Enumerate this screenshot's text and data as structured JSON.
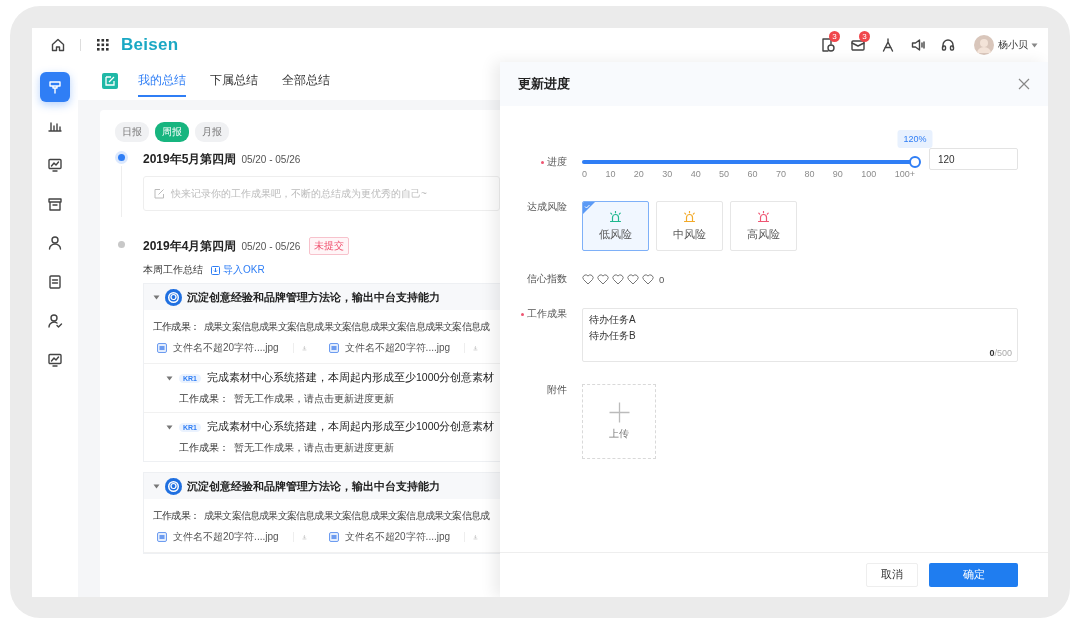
{
  "topbar": {
    "logo": "Beisen",
    "notifications": [
      {
        "badge": "3"
      },
      {
        "badge": "3"
      }
    ],
    "user": {
      "name": "杨小贝"
    }
  },
  "sidebar": {
    "items": [
      {
        "selected": true
      },
      {
        "selected": false
      },
      {
        "selected": false
      },
      {
        "selected": false
      },
      {
        "selected": false
      },
      {
        "selected": false
      },
      {
        "selected": false
      },
      {
        "selected": false
      }
    ]
  },
  "tabs": [
    {
      "label": "我的总结",
      "selected": true
    },
    {
      "label": "下属总结",
      "selected": false
    },
    {
      "label": "全部总结",
      "selected": false
    }
  ],
  "filters": [
    {
      "label": "日报",
      "selected": false
    },
    {
      "label": "周报",
      "selected": true
    },
    {
      "label": "月报",
      "selected": false
    }
  ],
  "weeks": [
    {
      "title": "2019年5月第四周",
      "range": "05/20 - 05/26",
      "current": true,
      "placeholder": "快来记录你的工作成果吧，不断的总结成为更优秀的自己~"
    },
    {
      "title": "2019年4月第四周",
      "range": "05/20 - 05/26",
      "current": false,
      "status": "未提交",
      "section_label": "本周工作总结",
      "import_link": "导入OKR",
      "objectives": [
        {
          "badge": "O",
          "title": "沉淀创意经验和品牌管理方法论，输出中台支持能力",
          "expanded": true,
          "result_label": "工作成果：",
          "result": "成果文案信息成果文案信息成果文案信息成果文案信息成果文案信息成",
          "files": [
            "文件名不超20字符....jpg",
            "文件名不超20字符....jpg"
          ],
          "key_results": [
            {
              "badge": "KR1",
              "title": "完成素材中心系统搭建，本周起内形成至少1000分创意素材",
              "expanded": true,
              "result_label": "工作成果：",
              "result": "暂无工作成果，请点击更新进度更新"
            },
            {
              "badge": "KR1",
              "title": "完成素材中心系统搭建，本周起内形成至少1000分创意素材",
              "expanded": true,
              "result_label": "工作成果：",
              "result": "暂无工作成果，请点击更新进度更新"
            }
          ]
        },
        {
          "badge": "O",
          "title": "沉淀创意经验和品牌管理方法论，输出中台支持能力",
          "expanded": true,
          "result_label": "工作成果：",
          "result": "成果文案信息成果文案信息成果文案信息成果文案信息成果文案信息成",
          "files": [
            "文件名不超20字符....jpg",
            "文件名不超20字符....jpg"
          ]
        }
      ]
    }
  ],
  "drawer": {
    "title": "更新进度",
    "progress": {
      "label": "进度",
      "required": true,
      "tooltip": "120%",
      "level": 1,
      "ticks": [
        "0",
        "10",
        "20",
        "30",
        "40",
        "50",
        "60",
        "70",
        "80",
        "90",
        "100",
        "100+"
      ],
      "value": "120"
    },
    "risk": {
      "label": "达成风险",
      "options": [
        {
          "label": "低风险",
          "color": "#1fb88e",
          "selected": true
        },
        {
          "label": "中风险",
          "color": "#f2a928",
          "selected": false
        },
        {
          "label": "高风险",
          "color": "#ee5572",
          "selected": false
        }
      ]
    },
    "confidence": {
      "label": "信心指数",
      "stars": 0,
      "reading": "0"
    },
    "result": {
      "label": "工作成果",
      "required": true,
      "value": "待办任务A\n待办任务B",
      "counter": "**0**/500"
    },
    "attachment": {
      "label": "附件",
      "upload_label": "上传"
    },
    "buttons": [
      {
        "label": "取消",
        "kind": "secondary"
      },
      {
        "label": "确定",
        "kind": "primary"
      }
    ]
  }
}
